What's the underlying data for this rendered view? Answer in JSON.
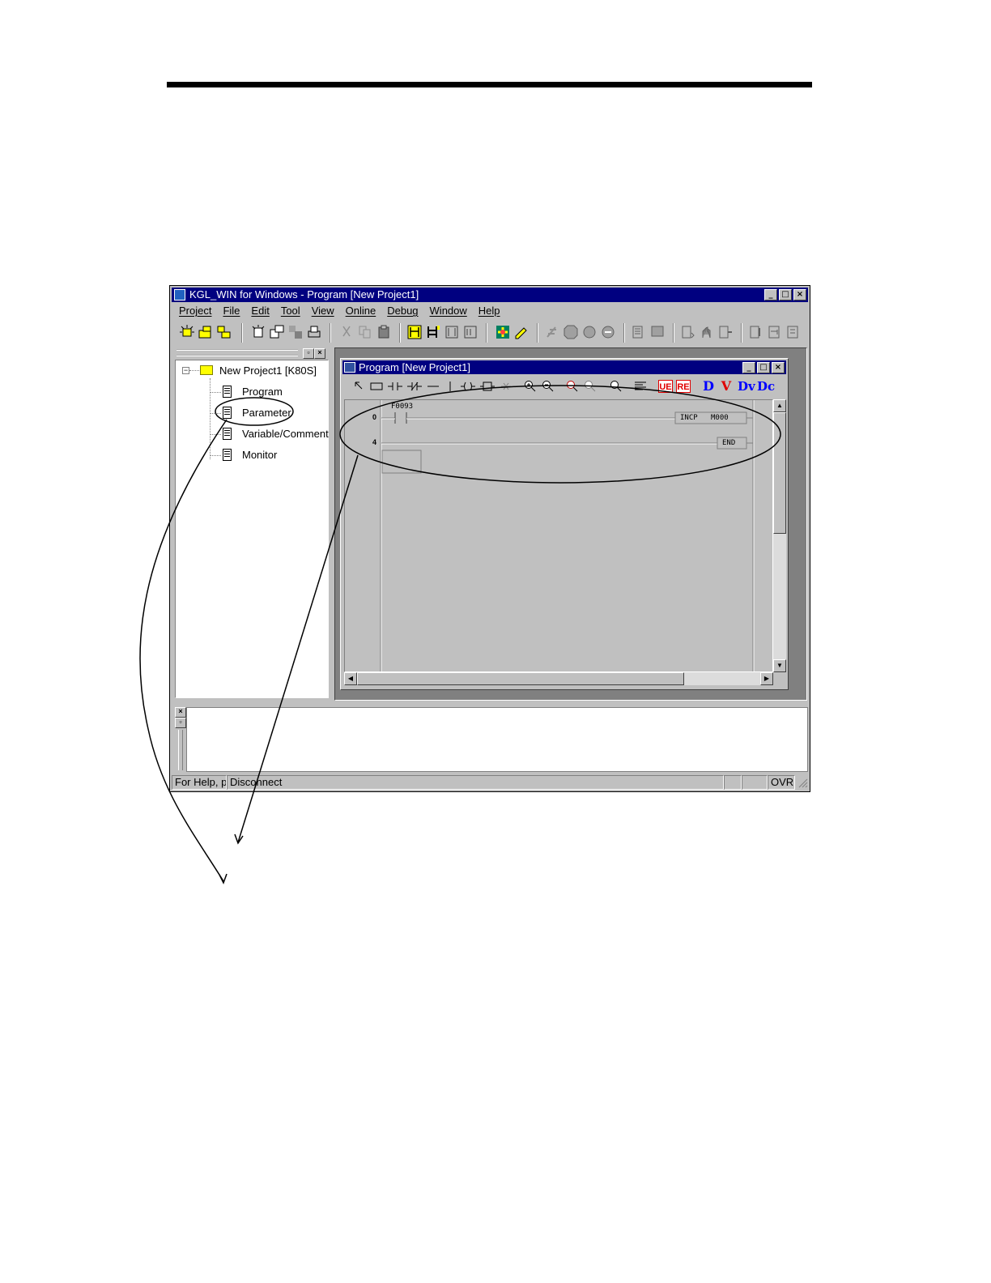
{
  "window": {
    "title": "KGL_WIN for Windows - Program [New Project1]",
    "buttons": {
      "minimize": "_",
      "maximize": "□",
      "close": "×"
    }
  },
  "menu": [
    "Project",
    "File",
    "Edit",
    "Tool",
    "View",
    "Online",
    "Debug",
    "Window",
    "Help"
  ],
  "project_tree": {
    "root": "New Project1 [K80S]",
    "items": [
      "Program",
      "Parameter",
      "Variable/Comment",
      "Monitor"
    ]
  },
  "program_window": {
    "title": "Program [New Project1]",
    "toolbar_letters": {
      "d": "D",
      "v": "V",
      "dv": "Dv",
      "dc": "Dc",
      "ue": "UE",
      "re": "RE"
    }
  },
  "ladder": {
    "rungs": [
      {
        "step": "0",
        "contact": "F0093",
        "instruction": "INCP",
        "operand": "M000"
      },
      {
        "step": "4",
        "instruction": "END"
      }
    ]
  },
  "status": {
    "help": "For Help, p",
    "connection": "Disconnect",
    "mode": "OVR"
  },
  "colors": {
    "title_bar": "#000080",
    "face": "#c0c0c0",
    "d_icon": "#0000ff",
    "v_icon": "#e00000",
    "dc_icon": "#008000"
  }
}
